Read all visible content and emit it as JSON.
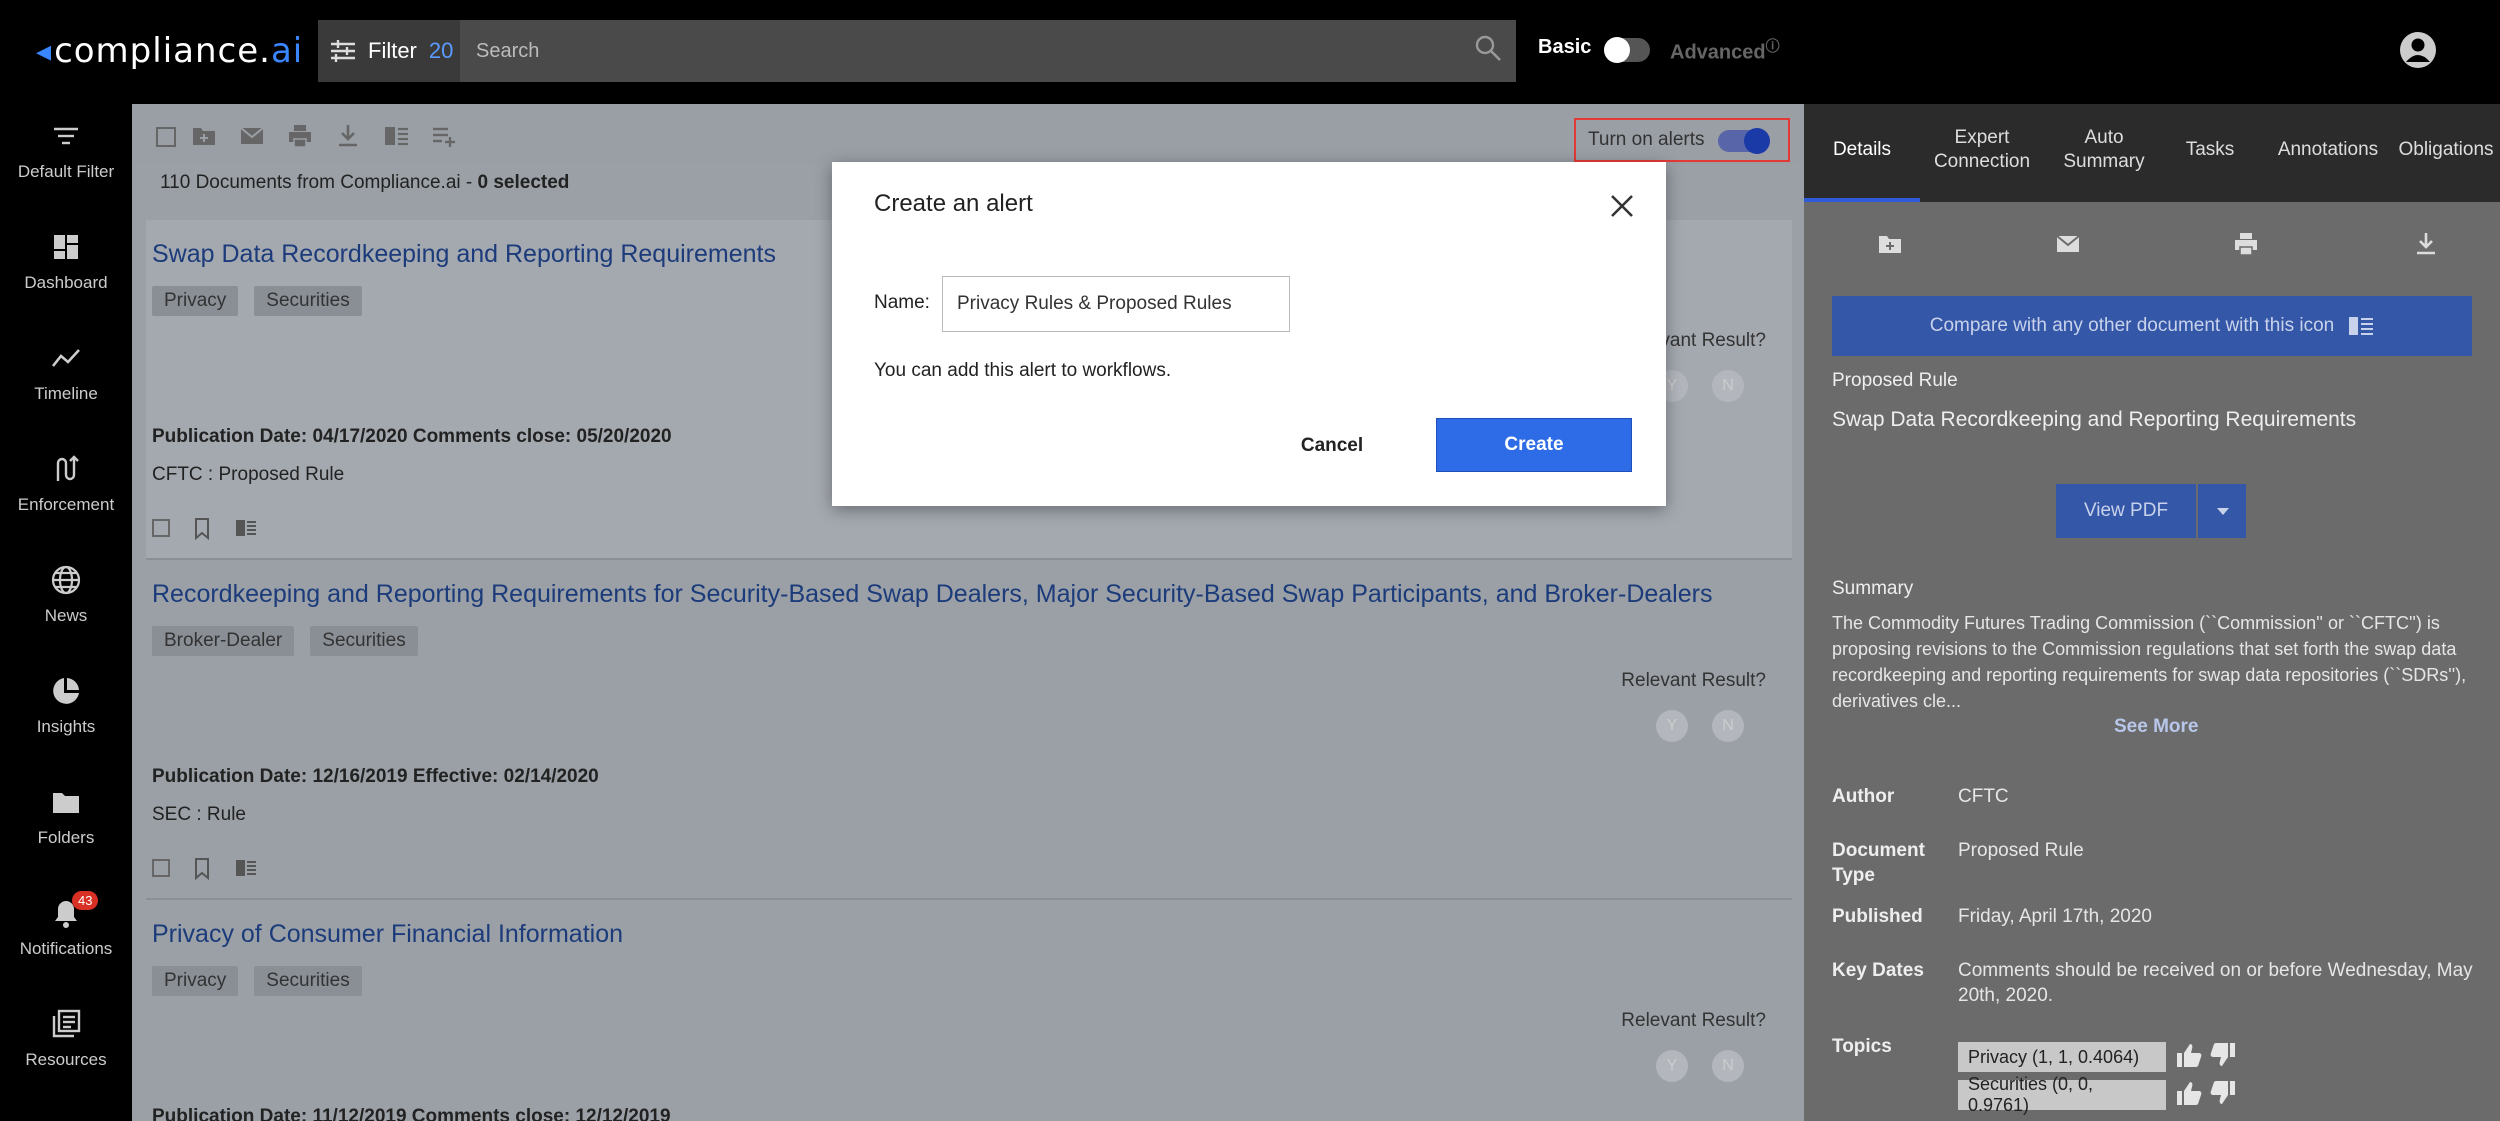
{
  "header": {
    "logo_main": "compliance.",
    "logo_ai": "ai",
    "filter_label": "Filter",
    "filter_count": "20",
    "search_placeholder": "Search",
    "mode_basic": "Basic",
    "mode_advanced": "Advanced"
  },
  "sidebar": {
    "items": [
      {
        "label": "Default Filter",
        "icon": "filter-lines-icon"
      },
      {
        "label": "Dashboard",
        "icon": "dashboard-icon"
      },
      {
        "label": "Timeline",
        "icon": "timeline-icon"
      },
      {
        "label": "Enforcement",
        "icon": "enforcement-icon"
      },
      {
        "label": "News",
        "icon": "globe-icon"
      },
      {
        "label": "Insights",
        "icon": "pie-chart-icon"
      },
      {
        "label": "Folders",
        "icon": "folder-icon"
      },
      {
        "label": "Notifications",
        "icon": "bell-icon",
        "badge": "43"
      },
      {
        "label": "Resources",
        "icon": "library-icon"
      }
    ]
  },
  "list": {
    "alerts_label": "Turn on alerts",
    "count_text": "110 Documents from Compliance.ai - ",
    "selected_text": "0 selected",
    "relevant_label": "Relevant Result?",
    "yes": "Y",
    "no": "N",
    "documents": [
      {
        "title": "Swap Data Recordkeeping and Reporting Requirements",
        "tags": [
          "Privacy",
          "Securities"
        ],
        "pub_label": "Publication Date:",
        "pub_date": "04/17/2020",
        "second_label": "Comments close:",
        "second_date": "05/20/2020",
        "agency": "CFTC",
        "doc_type": "Proposed Rule"
      },
      {
        "title": "Recordkeeping and Reporting Requirements for Security-Based Swap Dealers, Major Security-Based Swap Participants, and Broker-Dealers",
        "tags": [
          "Broker-Dealer",
          "Securities"
        ],
        "pub_label": "Publication Date:",
        "pub_date": "12/16/2019",
        "second_label": "Effective:",
        "second_date": "02/14/2020",
        "agency": "SEC",
        "doc_type": "Rule"
      },
      {
        "title": "Privacy of Consumer Financial Information",
        "tags": [
          "Privacy",
          "Securities"
        ],
        "pub_label": "Publication Date:",
        "pub_date": "11/12/2019",
        "second_label": "Comments close:",
        "second_date": "12/12/2019"
      }
    ]
  },
  "panel": {
    "tabs": [
      {
        "label": "Details"
      },
      {
        "label": "Expert Connection"
      },
      {
        "label": "Auto Summary"
      },
      {
        "label": "Tasks"
      },
      {
        "label": "Annotations"
      },
      {
        "label": "Obligations"
      }
    ],
    "compare_text": "Compare with any other document with this icon",
    "doc_type": "Proposed Rule",
    "title": "Swap Data Recordkeeping and Reporting Requirements",
    "view_pdf": "View PDF",
    "summary_heading": "Summary",
    "summary": "The Commodity Futures Trading Commission (``Commission'' or ``CFTC'') is proposing revisions to the Commission regulations that set forth the swap data recordkeeping and reporting requirements for swap data repositories (``SDRs''), derivatives cle...",
    "see_more": "See More",
    "author_label": "Author",
    "author": "CFTC",
    "doctype_label_1": "Document",
    "doctype_label_2": "Type",
    "doctype_value": "Proposed Rule",
    "published_label": "Published",
    "published": "Friday, April 17th, 2020",
    "keydates_label": "Key Dates",
    "keydates": "Comments should be received on or before Wednesday, May 20th, 2020.",
    "topics_label": "Topics",
    "topics": [
      "Privacy (1, 1, 0.4064)",
      "Securities (0, 0, 0.9761)"
    ]
  },
  "modal": {
    "title": "Create an alert",
    "name_label": "Name:",
    "name_value": "Privacy Rules & Proposed Rules",
    "hint": "You can add this alert to workflows.",
    "cancel": "Cancel",
    "create": "Create"
  }
}
